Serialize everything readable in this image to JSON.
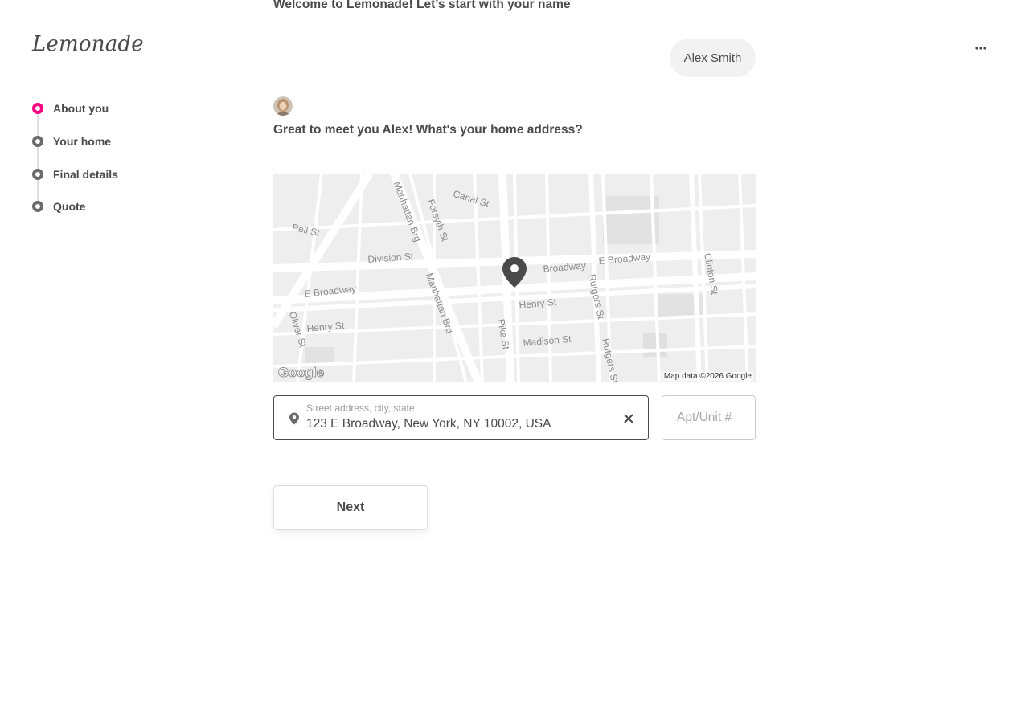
{
  "brand": {
    "logo_text": "Lemonade",
    "accent_color": "#ff0083"
  },
  "header": {
    "menu_icon": "more-horizontal-icon"
  },
  "steps": [
    {
      "label": "About you",
      "active": true
    },
    {
      "label": "Your home",
      "active": false
    },
    {
      "label": "Final details",
      "active": false
    },
    {
      "label": "Quote",
      "active": false
    }
  ],
  "chat": {
    "previous_question": "Welcome to Lemonade! Let’s start with your name",
    "user_answer": "Alex Smith",
    "current_question": "Great to meet you Alex! What's your home address?"
  },
  "map": {
    "streets": [
      "Canal St",
      "Pell St",
      "Manhattan Brg",
      "Forsyth St",
      "Division St",
      "Broadway",
      "E Broadway",
      "Clinton St",
      "Henry St",
      "Rutgers St",
      "Oliver St",
      "Madison St",
      "Pike St",
      "E Broadway",
      "Manhattan Brg",
      "Henry St",
      "Rutgers St"
    ],
    "provider_logo": "Google",
    "attribution": "Map data ©2026 Google"
  },
  "address": {
    "label": "Street address, city, state",
    "value": "123 E Broadway, New York, NY 10002, USA",
    "pin_icon": "location-pin-icon",
    "clear_icon": "close-icon"
  },
  "apt": {
    "placeholder": "Apt/Unit #",
    "value": ""
  },
  "actions": {
    "next_label": "Next"
  }
}
